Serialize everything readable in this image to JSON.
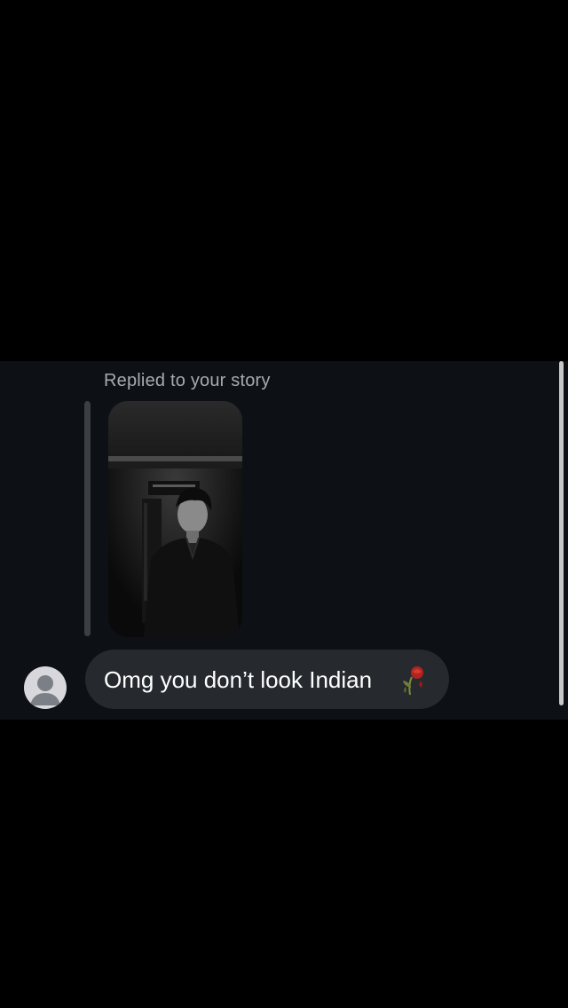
{
  "conversation": {
    "reply_caption": "Replied to your story",
    "story_preview": {
      "icon": "story-photo"
    },
    "message": {
      "text": "Omg you don’t look Indian",
      "emoji_icon": "wilted-rose-icon"
    },
    "avatar_icon": "default-avatar-icon"
  },
  "colors": {
    "background": "#000000",
    "chat_panel": "#0d1116",
    "bubble": "#262a2f",
    "caption_text": "#a6abb1",
    "message_text": "#ffffff"
  }
}
